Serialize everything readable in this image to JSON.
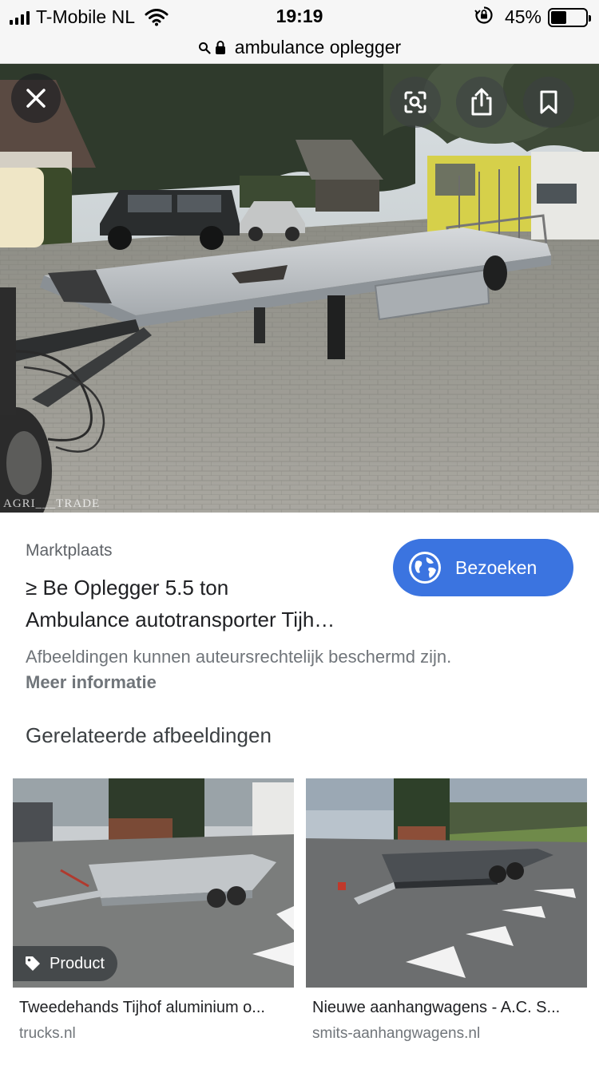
{
  "status_bar": {
    "carrier": "T-Mobile NL",
    "time": "19:19",
    "battery_percent": "45%",
    "battery_level": 0.45,
    "icons": [
      "signal-icon",
      "wifi-icon",
      "rotation-lock-icon",
      "battery-icon"
    ]
  },
  "url_bar": {
    "query": "ambulance oplegger",
    "icons": [
      "search-icon",
      "lock-icon"
    ]
  },
  "hero": {
    "watermark": "AGRI___TRADE",
    "buttons": [
      "close-icon",
      "lens-icon",
      "share-icon",
      "bookmark-icon"
    ]
  },
  "result": {
    "source": "Marktplaats",
    "title_line1": "≥ Be Oplegger 5.5 ton",
    "title_line2": "Ambulance autotransporter Tijh…",
    "visit_label": "Bezoeken",
    "copyright_notice": "Afbeeldingen kunnen auteursrechtelijk beschermd zijn.",
    "more_info": "Meer informatie"
  },
  "related": {
    "heading": "Gerelateerde afbeeldingen",
    "items": [
      {
        "title": "Tweedehands Tijhof aluminium o...",
        "source": "trucks.nl",
        "badge": "Product"
      },
      {
        "title": "Nieuwe aanhangwagens - A.C. S...",
        "source": "smits-aanhangwagens.nl"
      }
    ]
  },
  "colors": {
    "accent": "#3b74e0",
    "status_bar_bg": "#f6f6f6",
    "secondary_text": "#70757a"
  }
}
